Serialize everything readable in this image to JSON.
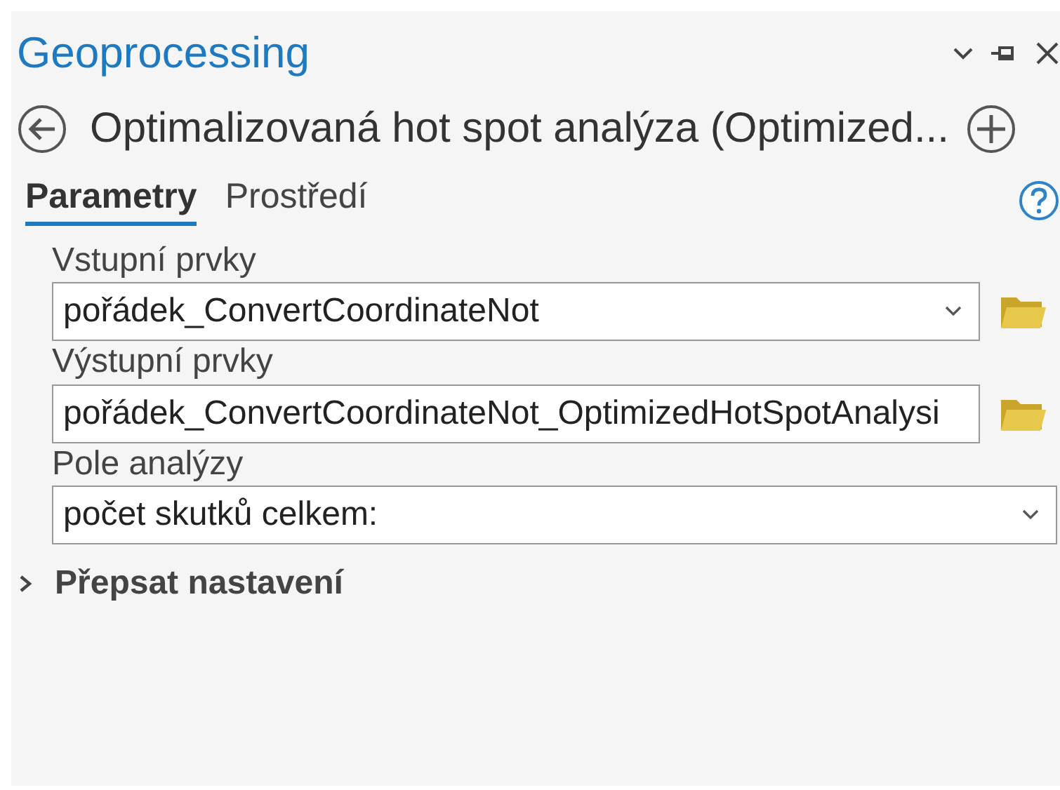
{
  "pane": {
    "title": "Geoprocessing"
  },
  "tool": {
    "title": "Optimalizovaná hot spot analýza (Optimized..."
  },
  "tabs": [
    {
      "label": "Parametry",
      "selected": true
    },
    {
      "label": "Prostředí",
      "selected": false
    }
  ],
  "parameters": [
    {
      "label": "Vstupní prvky",
      "kind": "dropdown",
      "value": "pořádek_ConvertCoordinateNot",
      "browse": true
    },
    {
      "label": "Výstupní prvky",
      "kind": "text",
      "value": "pořádek_ConvertCoordinateNot_OptimizedHotSpotAnalysi",
      "browse": true
    },
    {
      "label": "Pole analýzy",
      "kind": "dropdown",
      "value": "počet skutků celkem:",
      "browse": false
    }
  ],
  "sections": [
    {
      "label": "Přepsat nastavení",
      "expanded": false
    }
  ]
}
